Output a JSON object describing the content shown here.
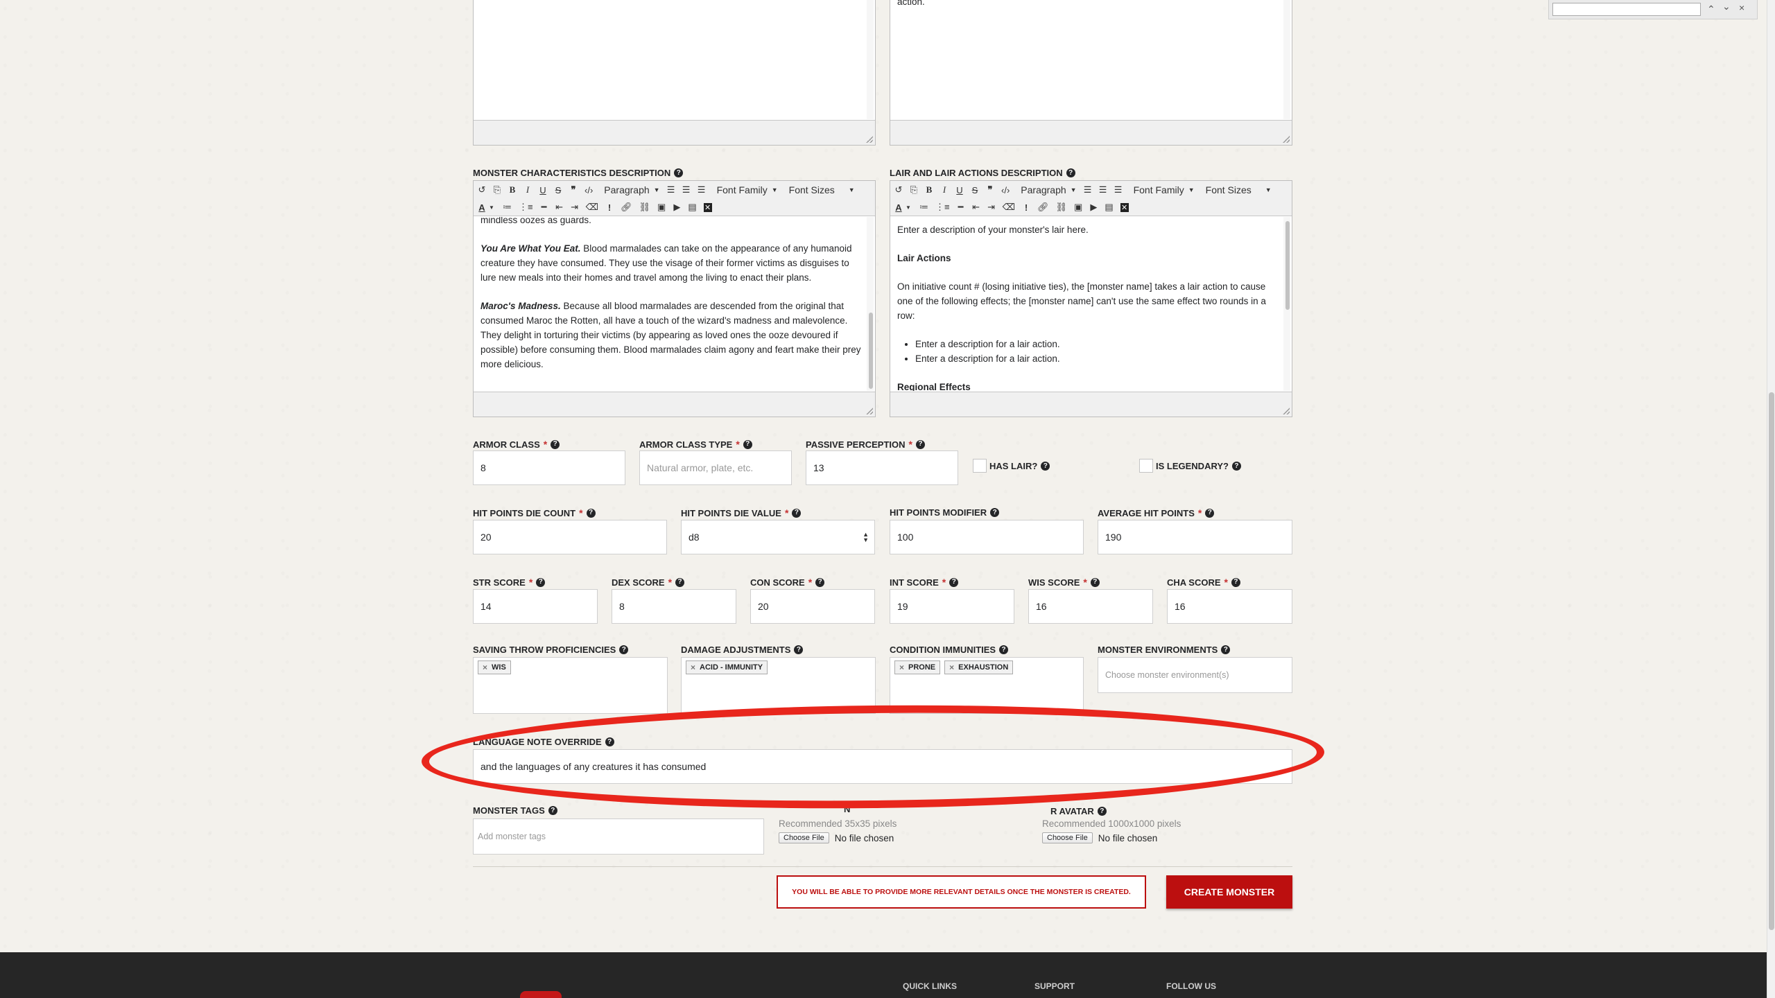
{
  "top_editors": {
    "right_text_tail": "action."
  },
  "find_bar": {
    "value": "",
    "up": "⌃",
    "down": "⌄",
    "close": "×"
  },
  "characteristics": {
    "label": "MONSTER CHARACTERISTICS DESCRIPTION",
    "paragraphs": [
      {
        "lead": "",
        "text": "mindless oozes as guards."
      },
      {
        "lead": "You Are What You Eat.",
        "text": " Blood marmalades can take on the appearance of any humanoid creature they have consumed. They use the visage of their former victims as disguises to lure new meals into their homes and travel among the living to enact their plans."
      },
      {
        "lead": "Maroc's Madness.",
        "text": " Because all blood marmalades are descended from the original that consumed Maroc the Rotten, all have a touch of the wizard's madness and malevolence. They delight in torturing their victims (by appearing as loved ones the ooze devoured if possible) before consuming them. Blood marmalades claim agony and feart make their prey more delicious."
      }
    ]
  },
  "lair": {
    "label": "LAIR AND LAIR ACTIONS DESCRIPTION",
    "intro": "Enter a description of your monster's lair here.",
    "heading": "Lair Actions",
    "body": "On initiative count # (losing initiative ties), the [monster name] takes a lair action to cause one of the following effects; the [monster name] can't use the same effect two rounds in a row:",
    "bullets": [
      "Enter a description for a lair action.",
      "Enter a description for a lair action."
    ],
    "heading2": "Regional Effects"
  },
  "toolbar": {
    "paragraph": "Paragraph",
    "font_family": "Font Family",
    "font_sizes": "Font Sizes"
  },
  "fields": {
    "armor_class": {
      "label": "ARMOR CLASS",
      "value": "8"
    },
    "armor_class_type": {
      "label": "ARMOR CLASS TYPE",
      "placeholder": "Natural armor, plate, etc."
    },
    "passive_perception": {
      "label": "PASSIVE PERCEPTION",
      "value": "13"
    },
    "has_lair": {
      "label": "HAS LAIR?"
    },
    "is_legendary": {
      "label": "IS LEGENDARY?"
    },
    "hp_die_count": {
      "label": "HIT POINTS DIE COUNT",
      "value": "20"
    },
    "hp_die_value": {
      "label": "HIT POINTS DIE VALUE",
      "value": "d8"
    },
    "hp_modifier": {
      "label": "HIT POINTS MODIFIER",
      "value": "100"
    },
    "avg_hp": {
      "label": "AVERAGE HIT POINTS",
      "value": "190"
    },
    "str": {
      "label": "STR SCORE",
      "value": "14"
    },
    "dex": {
      "label": "DEX SCORE",
      "value": "8"
    },
    "con": {
      "label": "CON SCORE",
      "value": "20"
    },
    "int": {
      "label": "INT SCORE",
      "value": "19"
    },
    "wis": {
      "label": "WIS SCORE",
      "value": "16"
    },
    "cha": {
      "label": "CHA SCORE",
      "value": "16"
    },
    "saving_throws": {
      "label": "SAVING THROW PROFICIENCIES",
      "tags": [
        "WIS"
      ]
    },
    "damage_adjustments": {
      "label": "DAMAGE ADJUSTMENTS",
      "tags": [
        "ACID - IMMUNITY"
      ]
    },
    "condition_immunities": {
      "label": "CONDITION IMMUNITIES",
      "tags": [
        "PRONE",
        "EXHAUSTION"
      ]
    },
    "environments": {
      "label": "MONSTER ENVIRONMENTS",
      "placeholder": "Choose monster environment(s)"
    },
    "language_note": {
      "label": "LANGUAGE NOTE OVERRIDE",
      "value": "and the languages of any creatures it has consumed"
    },
    "monster_tags": {
      "label": "MONSTER TAGS",
      "placeholder": "Add monster tags"
    },
    "token_upload": {
      "label_tail": "N",
      "hint": "Recommended 35x35 pixels",
      "button": "Choose File",
      "status": "No file chosen"
    },
    "avatar_upload": {
      "label": "R AVATAR",
      "hint": "Recommended 1000x1000 pixels",
      "button": "Choose File",
      "status": "No file chosen"
    }
  },
  "notice": "YOU WILL BE ABLE TO PROVIDE MORE RELEVANT DETAILS ONCE THE MONSTER IS CREATED.",
  "create_button": "CREATE MONSTER",
  "footer": {
    "links": [
      "QUICK LINKS",
      "SUPPORT",
      "FOLLOW US"
    ]
  },
  "colors": {
    "accent": "#bc0f0f",
    "annotation": "#e8261c",
    "footer_bg": "#262626"
  }
}
